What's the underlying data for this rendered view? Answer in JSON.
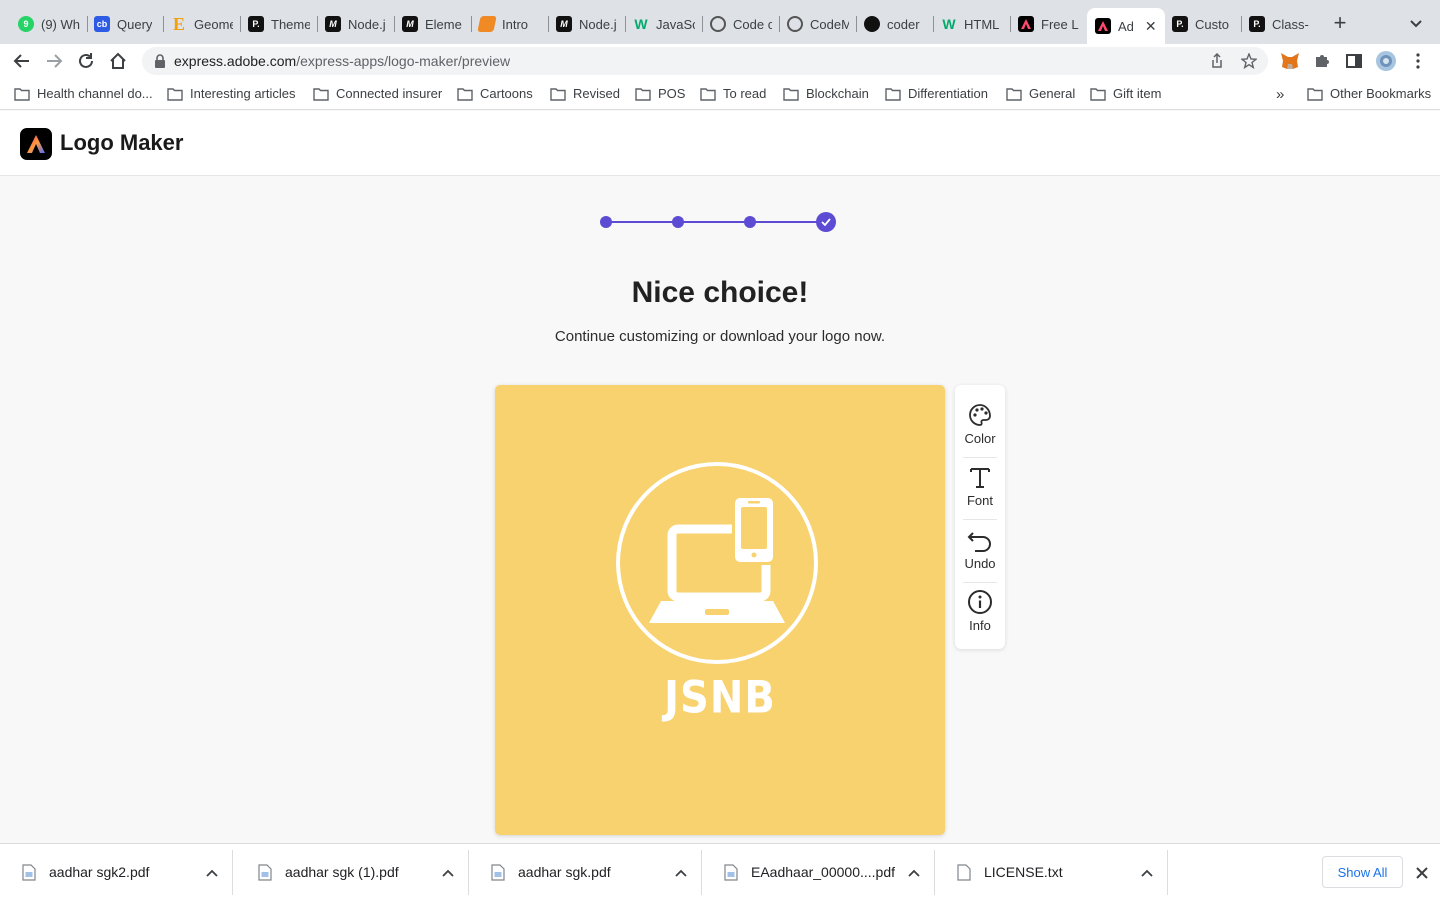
{
  "browser": {
    "tabs": [
      {
        "label": "(9) Wh",
        "icon": "whatsapp-icon",
        "color": "#25d366"
      },
      {
        "label": "Query",
        "icon": "cb-icon",
        "color": "#2d5be3"
      },
      {
        "label": "Geome",
        "icon": "e-icon",
        "color": "#f59e0b"
      },
      {
        "label": "Theme",
        "icon": "p-icon",
        "color": "#111111"
      },
      {
        "label": "Node.j",
        "icon": "m-icon",
        "color": "#111111"
      },
      {
        "label": "Eleme",
        "icon": "m-icon",
        "color": "#111111"
      },
      {
        "label": "Intro",
        "icon": "book-icon",
        "color": "#f08a24"
      },
      {
        "label": "Node.j",
        "icon": "m-icon",
        "color": "#111111"
      },
      {
        "label": "JavaSc",
        "icon": "w-icon",
        "color": "#04aa6d"
      },
      {
        "label": "Code c",
        "icon": "codepen-icon",
        "color": "#555555"
      },
      {
        "label": "CodeM",
        "icon": "codepen-icon",
        "color": "#555555"
      },
      {
        "label": "coder",
        "icon": "github-icon",
        "color": "#111111"
      },
      {
        "label": "HTML",
        "icon": "w-icon",
        "color": "#04aa6d"
      },
      {
        "label": "Free L",
        "icon": "adobe-icon",
        "color": "#000000"
      },
      {
        "label": "Ad",
        "icon": "adobe-icon",
        "color": "#000000"
      },
      {
        "label": "Custo",
        "icon": "p-icon",
        "color": "#111111"
      },
      {
        "label": "Class-",
        "icon": "p-icon",
        "color": "#111111"
      }
    ],
    "new_tab_label": "+",
    "url_host": "express.adobe.com",
    "url_path": "/express-apps/logo-maker/preview",
    "bookmarks": [
      "Health channel do...",
      "Interesting articles",
      "Connected insurer",
      "Cartoons",
      "Revised",
      "POS",
      "To read",
      "Blockchain",
      "Differentiation",
      "General",
      "Gift item"
    ],
    "bookmarks_overflow": "»",
    "other_bookmarks": "Other Bookmarks"
  },
  "app": {
    "title": "Logo Maker",
    "steps_total": 4,
    "steps_completed": 4,
    "heading": "Nice choice!",
    "subheading": "Continue customizing or download your logo now.",
    "logo_preview": {
      "brand_text": "JSNB",
      "background_color": "#f8d26f",
      "foreground_color": "#ffffff",
      "emblem_icon": "laptop-phone-icon"
    },
    "tools": [
      {
        "label": "Color",
        "icon": "palette-icon"
      },
      {
        "label": "Font",
        "icon": "text-icon"
      },
      {
        "label": "Undo",
        "icon": "undo-icon"
      },
      {
        "label": "Info",
        "icon": "info-icon"
      }
    ],
    "accent_color": "#5c4bd3"
  },
  "downloads": {
    "items": [
      "aadhar sgk2.pdf",
      "aadhar sgk (1).pdf",
      "aadhar sgk.pdf",
      "EAadhaar_00000....pdf",
      "LICENSE.txt"
    ],
    "show_all_label": "Show All"
  }
}
